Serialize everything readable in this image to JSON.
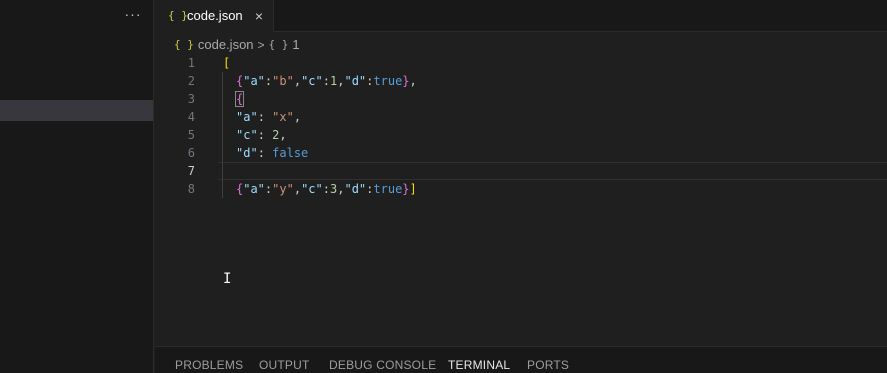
{
  "sidebar": {
    "more_label": "···"
  },
  "tab": {
    "icon": "{ }",
    "label": "code.json",
    "close": "×"
  },
  "breadcrumb": {
    "icon": "{ }",
    "file": "code.json",
    "sep": ">",
    "brace": "{ }",
    "item": "1"
  },
  "editor": {
    "line_numbers": [
      "1",
      "2",
      "3",
      "4",
      "5",
      "6",
      "7",
      "8"
    ],
    "active_line": "7"
  },
  "panel": {
    "tabs": [
      "PROBLEMS",
      "OUTPUT",
      "DEBUG CONSOLE",
      "TERMINAL",
      "PORTS"
    ],
    "active_tab": "TERMINAL"
  },
  "colors": {
    "bracket_level1": "#ffd700",
    "bracket_level2": "#da70d6",
    "key": "#9cdcfe",
    "string": "#ce9178",
    "number": "#b5cea8",
    "boolean": "#569cd6"
  },
  "code_tokens": {
    "l1": {
      "open": "["
    },
    "l2": {
      "o": "{",
      "k1": "\"a\"",
      "c1": ":",
      "v1": "\"b\"",
      "m1": ",",
      "k2": "\"c\"",
      "c2": ":",
      "v2": "1",
      "m2": ",",
      "k3": "\"d\"",
      "c3": ":",
      "v3": "true",
      "close": "}",
      "m3": ","
    },
    "l3": {
      "o": "{"
    },
    "l4": {
      "k": "\"a\"",
      "c": ": ",
      "v": "\"x\"",
      "m": ","
    },
    "l5": {
      "k": "\"c\"",
      "c": ": ",
      "v": "2",
      "m": ","
    },
    "l6": {
      "k": "\"d\"",
      "c": ": ",
      "v": "false"
    },
    "l8": {
      "o": "{",
      "k1": "\"a\"",
      "c1": ":",
      "v1": "\"y\"",
      "m1": ",",
      "k2": "\"c\"",
      "c2": ":",
      "v2": "3",
      "m2": ",",
      "k3": "\"d\"",
      "c3": ":",
      "v3": "true",
      "close": "}",
      "end": "]"
    }
  }
}
